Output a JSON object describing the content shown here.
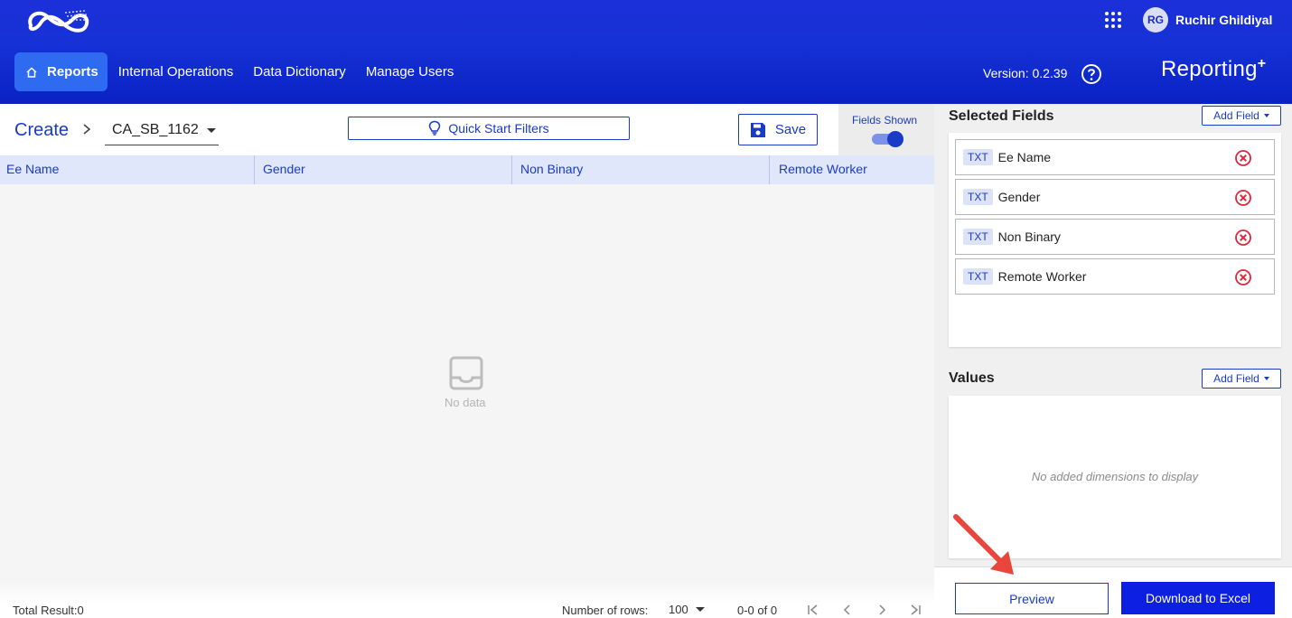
{
  "header": {
    "nav": [
      {
        "label": "Reports",
        "active": true
      },
      {
        "label": "Internal Operations"
      },
      {
        "label": "Data Dictionary"
      },
      {
        "label": "Manage Users"
      }
    ],
    "user_initials": "RG",
    "user_name": "Ruchir Ghildiyal",
    "version": "Version: 0.2.39",
    "brand": "Reporting",
    "brand_mark": "+"
  },
  "toolbar": {
    "breadcrumb_root": "Create",
    "report_name": "CA_SB_1162",
    "quick_start_label": "Quick Start Filters",
    "save_label": "Save",
    "fields_shown_label": "Fields Shown",
    "fields_shown_on": true
  },
  "table": {
    "columns": [
      "Ee Name",
      "Gender",
      "Non Binary",
      "Remote Worker"
    ],
    "empty_text": "No data"
  },
  "footer": {
    "total": "Total Result:0",
    "rows_label": "Number of rows:",
    "rows_value": "100",
    "range": "0-0 of 0"
  },
  "right_panel": {
    "selected_title": "Selected Fields",
    "add_field_label": "Add Field",
    "selected_fields": [
      {
        "type": "TXT",
        "name": "Ee Name"
      },
      {
        "type": "TXT",
        "name": "Gender"
      },
      {
        "type": "TXT",
        "name": "Non Binary"
      },
      {
        "type": "TXT",
        "name": "Remote Worker"
      }
    ],
    "values_title": "Values",
    "values_empty": "No added dimensions to display",
    "preview_label": "Preview",
    "download_label": "Download to Excel"
  },
  "colors": {
    "header": "#1632d6",
    "accent": "#1a3ac8",
    "primary_button": "#0d1fe0",
    "annotation_arrow": "#e8453c"
  }
}
